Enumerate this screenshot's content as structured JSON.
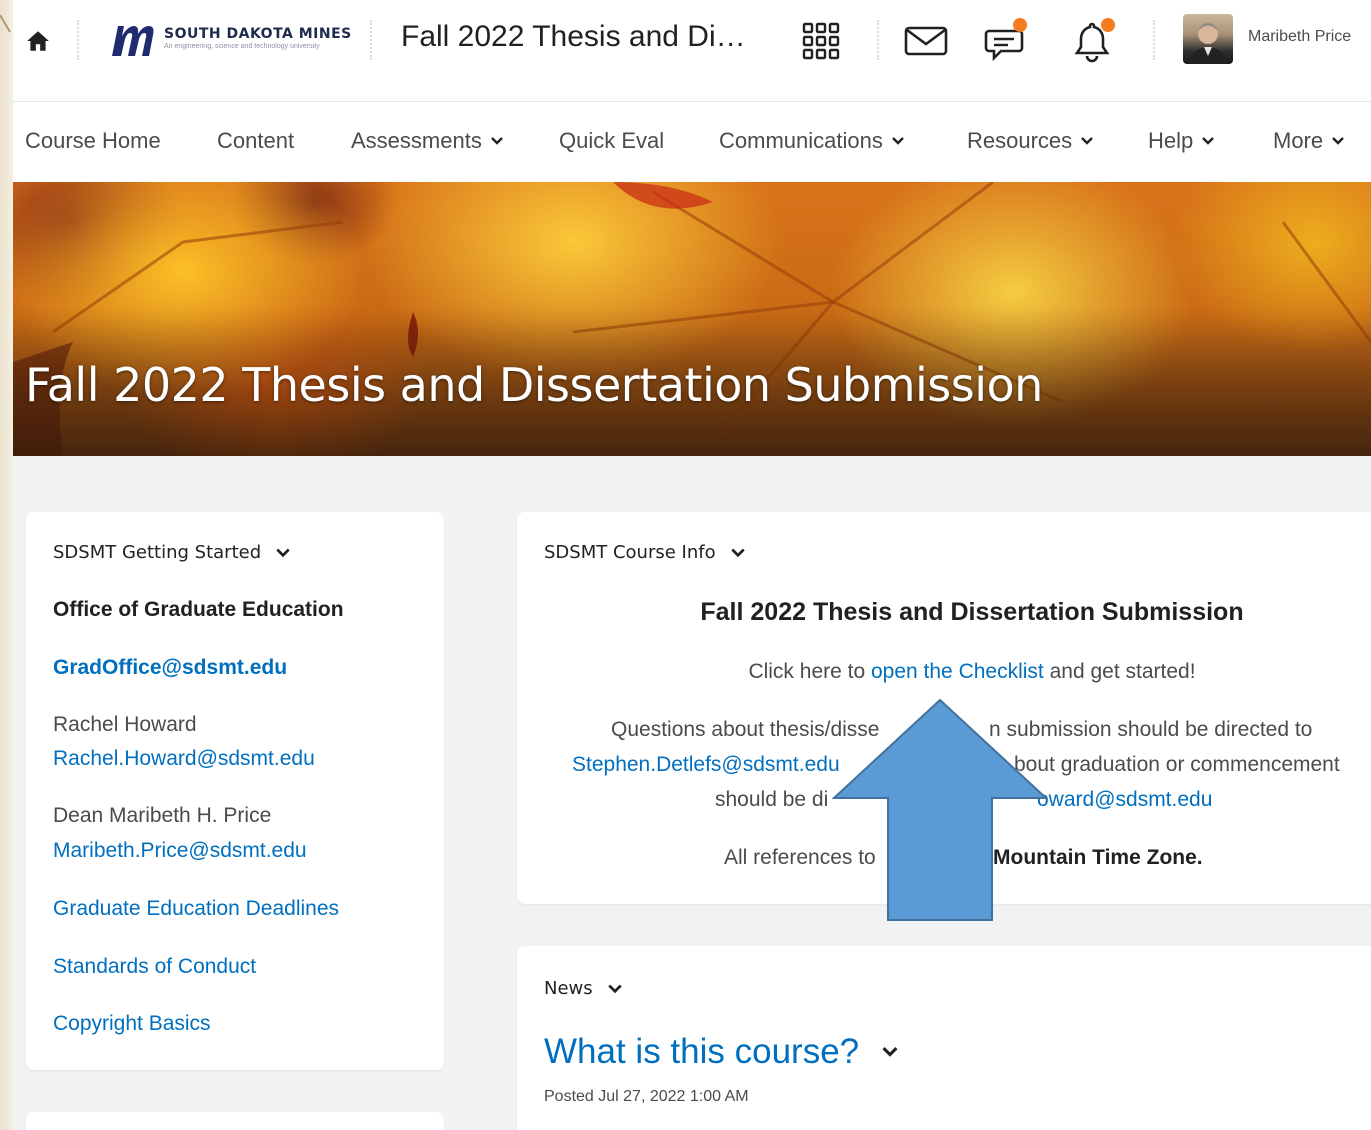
{
  "header": {
    "logo": {
      "name": "SOUTH DAKOTA MINES",
      "tagline": "An engineering, science and technology university"
    },
    "course_title": "Fall 2022 Thesis and Di…",
    "user_name": "Maribeth Price",
    "icons": [
      "home-icon",
      "waffle-grid-icon",
      "mail-icon",
      "chat-icon",
      "bell-icon"
    ],
    "accent": "#f47b20"
  },
  "nav": {
    "items": [
      {
        "label": "Course Home"
      },
      {
        "label": "Content"
      },
      {
        "label": "Assessments"
      },
      {
        "label": "Quick Eval"
      },
      {
        "label": "Communications"
      },
      {
        "label": "Resources"
      },
      {
        "label": "Help"
      },
      {
        "label": "More"
      }
    ]
  },
  "banner": {
    "title": "Fall 2022 Thesis and Dissertation Submission"
  },
  "getting_started": {
    "heading": "SDSMT Getting Started",
    "office": "Office of Graduate Education",
    "office_email": "GradOffice@sdsmt.edu",
    "contact1_name": "Rachel Howard",
    "contact1_email": "Rachel.Howard@sdsmt.edu",
    "contact2_name": "Dean Maribeth H. Price",
    "contact2_email": "Maribeth.Price@sdsmt.edu",
    "links": [
      "Graduate Education Deadlines",
      "Standards of Conduct",
      "Copyright Basics"
    ]
  },
  "course_info": {
    "heading": "SDSMT Course Info",
    "title": "Fall 2022 Thesis and Dissertation Submission",
    "checklist_prefix": "Click here to ",
    "checklist_link": "open the Checklist",
    "checklist_suffix": " and get started!",
    "q1_start": "Questions about thesis/disse",
    "q1_end": "n submission should be directed to",
    "q2_email": "Stephen.Detlefs@sdsmt.edu",
    "q2_end": "bout graduation or commencement",
    "q3_start": "should be di",
    "q3_email_end": "oward@sdsmt.edu",
    "tz_start": "All references to",
    "tz_end": "Mountain Time Zone."
  },
  "news": {
    "heading": "News",
    "title": "What is this course?",
    "posted": "Posted Jul 27, 2022 1:00 AM"
  },
  "colors": {
    "link": "#006fbf",
    "arrow": "#5b9bd5",
    "arrow_border": "#41719c"
  }
}
